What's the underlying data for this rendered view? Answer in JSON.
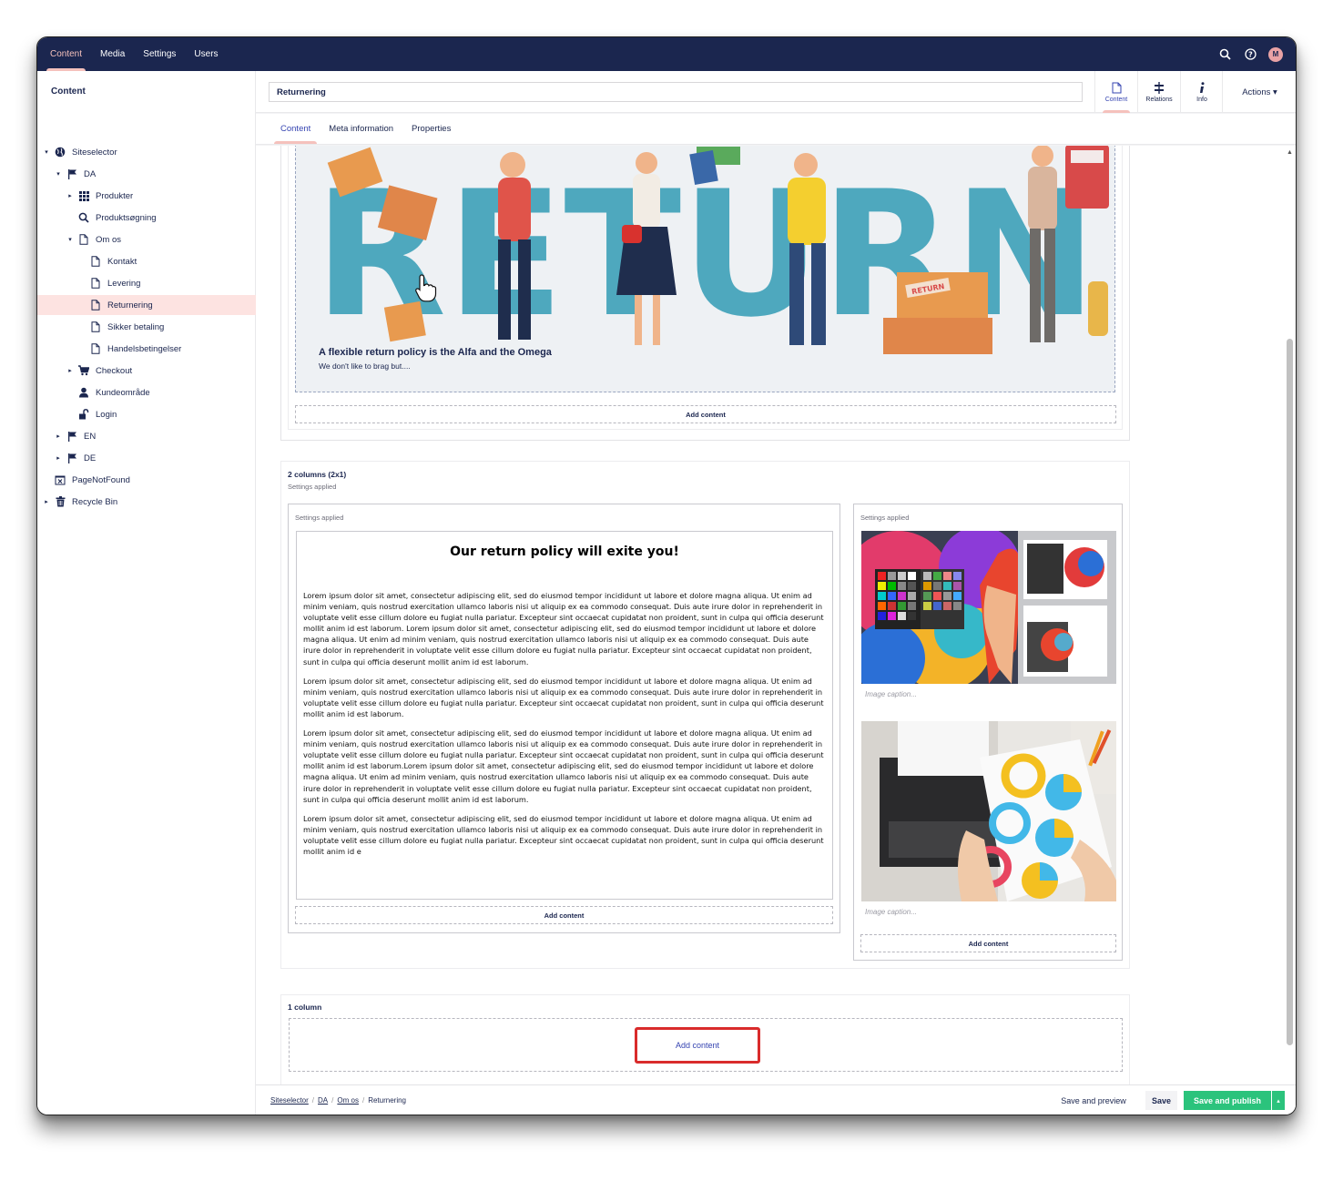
{
  "top_nav": {
    "items": [
      {
        "label": "Content",
        "active": true
      },
      {
        "label": "Media",
        "active": false
      },
      {
        "label": "Settings",
        "active": false
      },
      {
        "label": "Users",
        "active": false
      }
    ],
    "avatar_initial": "M",
    "icons": [
      "search-icon",
      "help-icon"
    ]
  },
  "tree": {
    "title": "Content",
    "nodes": [
      {
        "label": "Siteselector",
        "icon": "globe-icon",
        "caret": "▾",
        "level": 0
      },
      {
        "label": "DA",
        "icon": "flag-icon",
        "caret": "▾",
        "level": 1
      },
      {
        "label": "Produkter",
        "icon": "grid-icon",
        "caret": "▸",
        "level": 2
      },
      {
        "label": "Produktsøgning",
        "icon": "search-icon",
        "caret": "",
        "level": 2
      },
      {
        "label": "Om os",
        "icon": "document-icon",
        "caret": "▾",
        "level": 2
      },
      {
        "label": "Kontakt",
        "icon": "document-icon",
        "caret": "",
        "level": 3
      },
      {
        "label": "Levering",
        "icon": "document-icon",
        "caret": "",
        "level": 3
      },
      {
        "label": "Returnering",
        "icon": "document-icon",
        "caret": "",
        "level": 3,
        "active": true
      },
      {
        "label": "Sikker betaling",
        "icon": "document-icon",
        "caret": "",
        "level": 3
      },
      {
        "label": "Handelsbetingelser",
        "icon": "document-icon",
        "caret": "",
        "level": 3
      },
      {
        "label": "Checkout",
        "icon": "cart-icon",
        "caret": "▸",
        "level": 2
      },
      {
        "label": "Kundeområde",
        "icon": "user-icon",
        "caret": "",
        "level": 2
      },
      {
        "label": "Login",
        "icon": "unlock-icon",
        "caret": "",
        "level": 2
      },
      {
        "label": "EN",
        "icon": "flag-icon",
        "caret": "▸",
        "level": 1
      },
      {
        "label": "DE",
        "icon": "flag-icon",
        "caret": "▸",
        "level": 1
      },
      {
        "label": "PageNotFound",
        "icon": "not-found-icon",
        "caret": "",
        "level": 0
      },
      {
        "label": "Recycle Bin",
        "icon": "trash-icon",
        "caret": "▸",
        "level": 0
      }
    ]
  },
  "editor": {
    "node_name": "Returnering",
    "apps": [
      {
        "label": "Content",
        "icon": "document-icon",
        "active": true
      },
      {
        "label": "Relations",
        "icon": "relations-icon",
        "active": false
      },
      {
        "label": "Info",
        "icon": "info-icon",
        "active": false
      }
    ],
    "actions_label": "Actions ▾",
    "tabs": [
      {
        "label": "Content",
        "active": true
      },
      {
        "label": "Meta information",
        "active": false
      },
      {
        "label": "Properties",
        "active": false
      }
    ]
  },
  "content": {
    "hero": {
      "title": "A flexible return policy is the Alfa and the Omega",
      "subtitle": "We don't like to brag but....",
      "word": "RETURN",
      "box_label": "RETURN"
    },
    "add_content": "Add content",
    "two_col": {
      "name": "2 columns (2x1)",
      "settings": "Settings applied",
      "left_settings": "Settings applied",
      "right_settings": "Settings applied",
      "heading": "Our return policy will exite you!",
      "paragraphs": [
        "Lorem ipsum dolor sit amet, consectetur adipiscing elit, sed do eiusmod tempor incididunt ut labore et dolore magna aliqua. Ut enim ad minim veniam, quis nostrud exercitation ullamco laboris nisi ut aliquip ex ea commodo consequat. Duis aute irure dolor in reprehenderit in voluptate velit esse cillum dolore eu fugiat nulla pariatur. Excepteur sint occaecat cupidatat non proident, sunt in culpa qui officia deserunt mollit anim id est laborum. Lorem ipsum dolor sit amet, consectetur adipiscing elit, sed do eiusmod tempor incididunt ut labore et dolore magna aliqua. Ut enim ad minim veniam, quis nostrud exercitation ullamco laboris nisi ut aliquip ex ea commodo consequat. Duis aute irure dolor in reprehenderit in voluptate velit esse cillum dolore eu fugiat nulla pariatur. Excepteur sint occaecat cupidatat non proident, sunt in culpa qui officia deserunt mollit anim id est laborum.",
        "Lorem ipsum dolor sit amet, consectetur adipiscing elit, sed do eiusmod tempor incididunt ut labore et dolore magna aliqua. Ut enim ad minim veniam, quis nostrud exercitation ullamco laboris nisi ut aliquip ex ea commodo consequat. Duis aute irure dolor in reprehenderit in voluptate velit esse cillum dolore eu fugiat nulla pariatur. Excepteur sint occaecat cupidatat non proident, sunt in culpa qui officia deserunt mollit anim id est laborum.",
        "Lorem ipsum dolor sit amet, consectetur adipiscing elit, sed do eiusmod tempor incididunt ut labore et dolore magna aliqua. Ut enim ad minim veniam, quis nostrud exercitation ullamco laboris nisi ut aliquip ex ea commodo consequat. Duis aute irure dolor in reprehenderit in voluptate velit esse cillum dolore eu fugiat nulla pariatur. Excepteur sint occaecat cupidatat non proident, sunt in culpa qui officia deserunt mollit anim id est laborum.Lorem ipsum dolor sit amet, consectetur adipiscing elit, sed do eiusmod tempor incididunt ut labore et dolore magna aliqua. Ut enim ad minim veniam, quis nostrud exercitation ullamco laboris nisi ut aliquip ex ea commodo consequat. Duis aute irure dolor in reprehenderit in voluptate velit esse cillum dolore eu fugiat nulla pariatur. Excepteur sint occaecat cupidatat non proident, sunt in culpa qui officia deserunt mollit anim id est laborum.",
        "Lorem ipsum dolor sit amet, consectetur adipiscing elit, sed do eiusmod tempor incididunt ut labore et dolore magna aliqua. Ut enim ad minim veniam, quis nostrud exercitation ullamco laboris nisi ut aliquip ex ea commodo consequat. Duis aute irure dolor in reprehenderit in voluptate velit esse cillum dolore eu fugiat nulla pariatur. Excepteur sint occaecat cupidatat non proident, sunt in culpa qui officia deserunt mollit anim id e"
      ],
      "image_caption_placeholder": "Image caption..."
    },
    "one_col": {
      "name": "1 column"
    }
  },
  "footer": {
    "breadcrumbs": [
      "Siteselector",
      "DA",
      "Om os",
      "Returnering"
    ],
    "save_preview": "Save and preview",
    "save": "Save",
    "save_publish": "Save and publish",
    "more": "▴"
  },
  "colors": {
    "nav_bg": "#1b264f",
    "accent_pink": "#f5c1bc",
    "active_node_bg": "#fde3e1",
    "publish_green": "#2bc37c",
    "highlight_red": "#d92b2b"
  }
}
